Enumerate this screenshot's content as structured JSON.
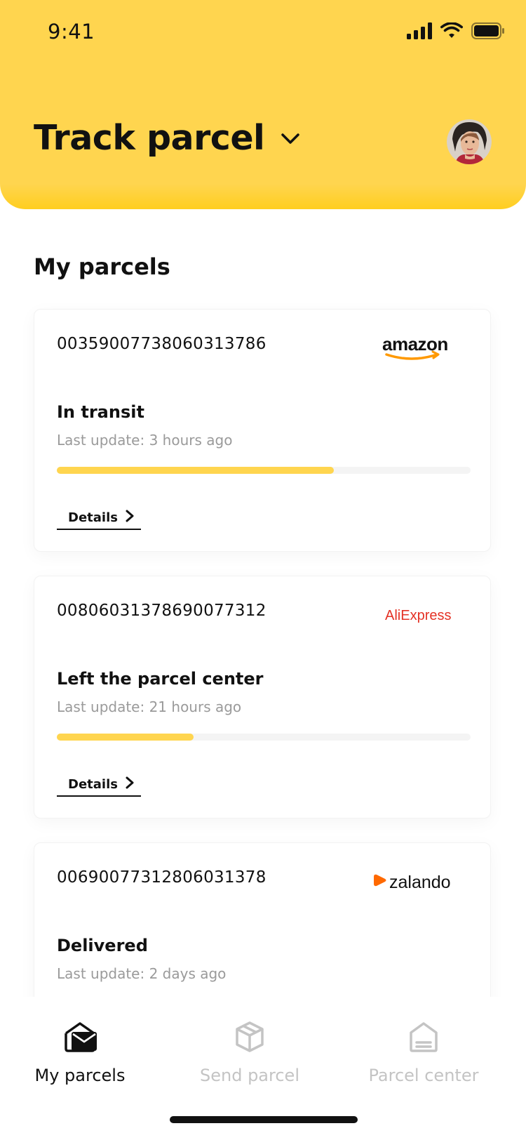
{
  "status_bar": {
    "time": "9:41"
  },
  "header": {
    "title": "Track parcel"
  },
  "section": {
    "title": "My parcels"
  },
  "parcels": [
    {
      "tracking": "00359007738060313786",
      "merchant": "amazon",
      "status": "In transit",
      "last_update": "Last update: 3 hours ago",
      "progress": 0.67,
      "details_label": "Details"
    },
    {
      "tracking": "00806031378690077312",
      "merchant": "AliExpress",
      "status": "Left the parcel center",
      "last_update": "Last update: 21 hours ago",
      "progress": 0.33,
      "details_label": "Details"
    },
    {
      "tracking": "00690077312806031378",
      "merchant": "zalando",
      "status": "Delivered",
      "last_update": "Last update: 2 days ago"
    }
  ],
  "tabs": [
    {
      "label": "My parcels",
      "icon": "mail-box-icon",
      "active": true
    },
    {
      "label": "Send parcel",
      "icon": "box-icon",
      "active": false
    },
    {
      "label": "Parcel center",
      "icon": "building-icon",
      "active": false
    }
  ],
  "colors": {
    "accent": "#FFD54F",
    "text": "#111111",
    "muted": "#9A9A9A",
    "inactive": "#C4C4C4",
    "aliexpress": "#E43225",
    "zalando": "#FF6900",
    "amazon_smile": "#FF9900"
  }
}
